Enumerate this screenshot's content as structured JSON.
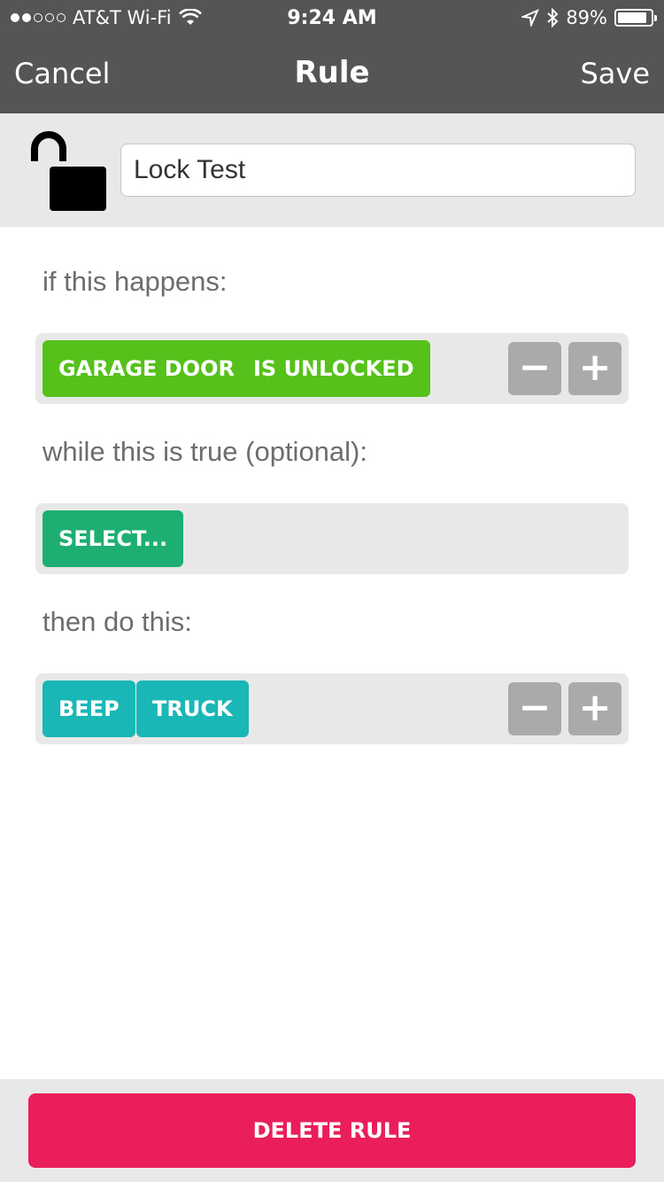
{
  "status_bar": {
    "carrier": "AT&T Wi-Fi",
    "time": "9:24 AM",
    "battery_percent": "89%",
    "battery_level": 0.89,
    "signal_dots_filled": 2,
    "signal_dots_total": 5
  },
  "nav": {
    "cancel_label": "Cancel",
    "title": "Rule",
    "save_label": "Save"
  },
  "rule": {
    "name_value": "Lock Test",
    "icon": "unlocked-padlock-icon"
  },
  "sections": {
    "trigger_label": "if this happens:",
    "trigger_chips": [
      "GARAGE DOOR",
      "IS UNLOCKED"
    ],
    "condition_label": "while this is true (optional):",
    "condition_chip": "SELECT...",
    "action_label": "then do this:",
    "action_chips": [
      "BEEP",
      "TRUCK"
    ],
    "minus_symbol": "−",
    "plus_symbol": "+"
  },
  "footer": {
    "delete_label": "DELETE RULE"
  },
  "colors": {
    "nav_bg": "#555555",
    "trigger_chip": "#55c11a",
    "condition_chip": "#1daf72",
    "action_chip": "#1ab7b7",
    "delete_button": "#e91e5b"
  }
}
